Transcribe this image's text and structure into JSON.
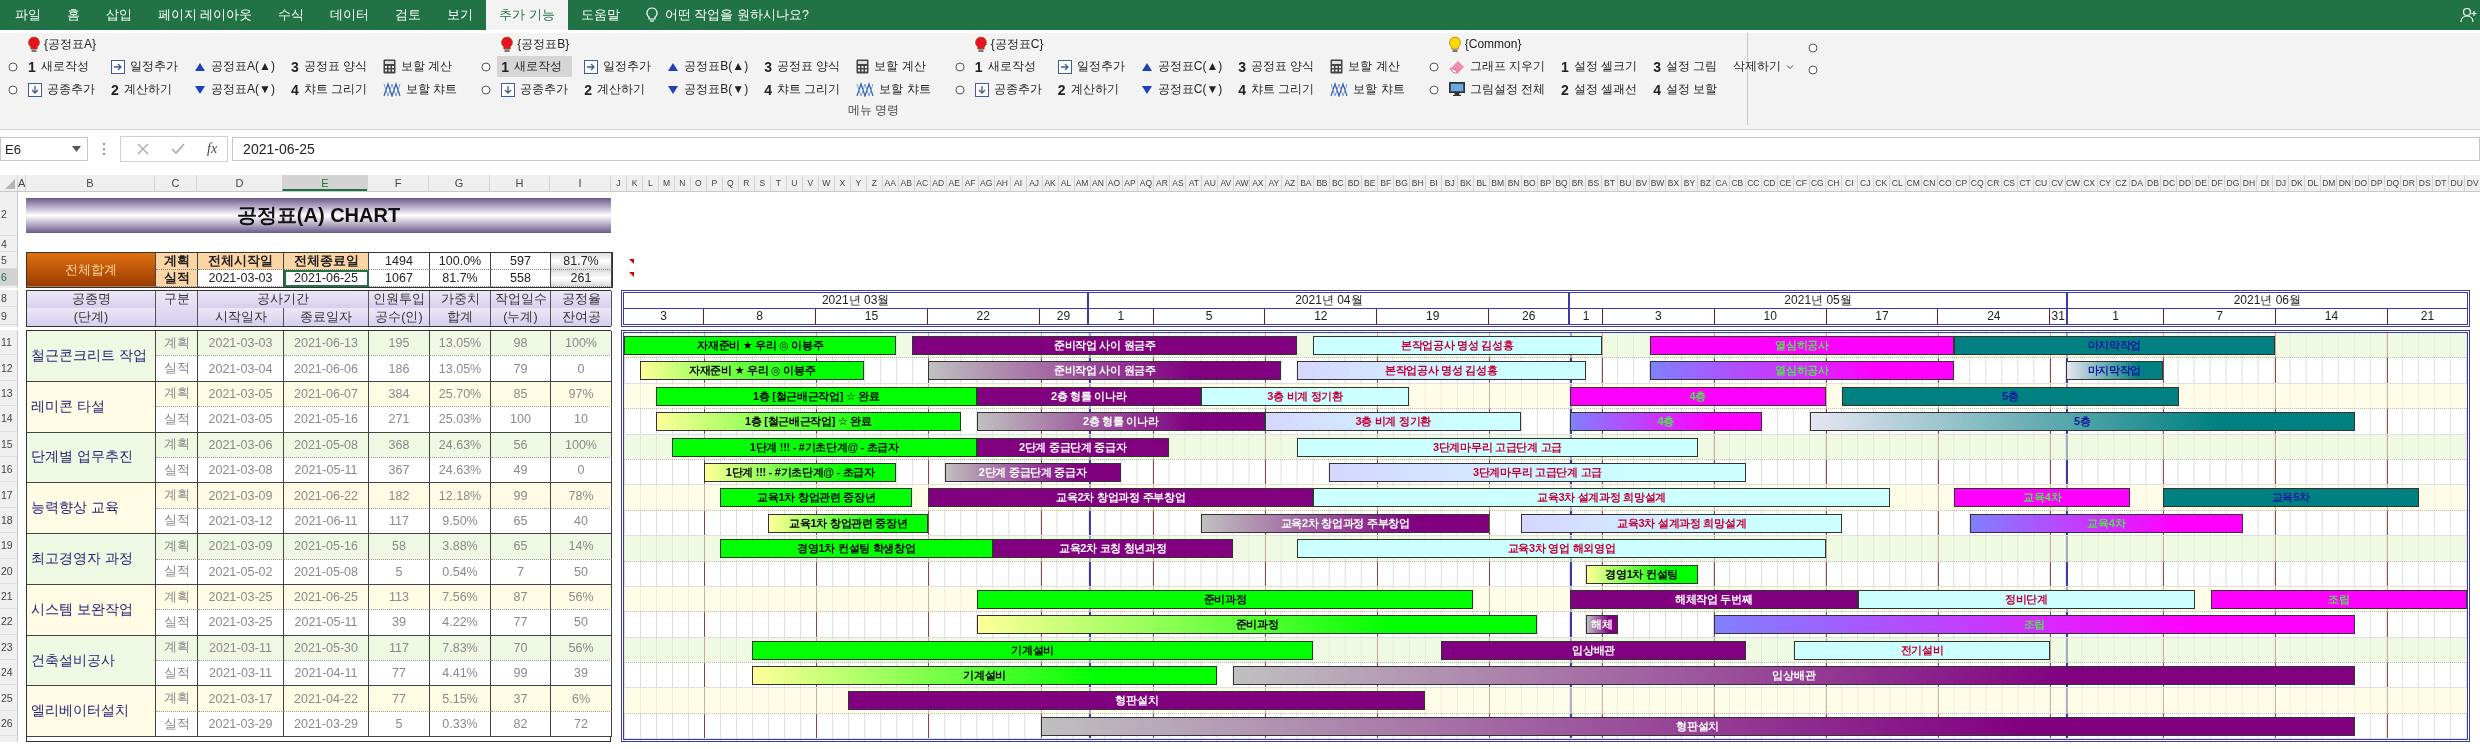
{
  "tabs": [
    {
      "label": "파일",
      "selected": false
    },
    {
      "label": "홈",
      "selected": false
    },
    {
      "label": "삽입",
      "selected": false
    },
    {
      "label": "페이지 레이아웃",
      "selected": false
    },
    {
      "label": "수식",
      "selected": false
    },
    {
      "label": "데이터",
      "selected": false
    },
    {
      "label": "검토",
      "selected": false
    },
    {
      "label": "보기",
      "selected": false
    },
    {
      "label": "추가 기능",
      "selected": true
    },
    {
      "label": "도움말",
      "selected": false
    }
  ],
  "tell_me": "어떤 작업을 원하시나요?",
  "ribbon": {
    "label": "메뉴 명령",
    "groups": [
      {
        "title": "{공정표A}",
        "color": "#e81123",
        "items": [
          {
            "kind": "numbered",
            "number": "1",
            "label": "새로작성",
            "highlighted": false
          },
          {
            "kind": "schedule-add",
            "label": "일정추가",
            "highlighted": false
          },
          {
            "kind": "move-up",
            "label": "공정표A(▲)",
            "highlighted": false
          },
          {
            "kind": "numbered",
            "number": "3",
            "label": "공정표 양식",
            "highlighted": false
          },
          {
            "kind": "calculator",
            "label": "보할 계산",
            "highlighted": false
          },
          {
            "kind": "item-add",
            "label": "공종추가",
            "highlighted": false
          },
          {
            "kind": "numbered",
            "number": "2",
            "label": "계산하기",
            "highlighted": false
          },
          {
            "kind": "move-down",
            "label": "공정표A(▼)",
            "highlighted": false
          },
          {
            "kind": "numbered",
            "number": "4",
            "label": "챠트 그리기",
            "highlighted": false
          },
          {
            "kind": "chart",
            "label": "보할 챠트",
            "highlighted": false
          }
        ]
      },
      {
        "title": "{공정표B}",
        "color": "#e81123",
        "items": [
          {
            "kind": "numbered",
            "number": "1",
            "label": "새로작성",
            "highlighted": true
          },
          {
            "kind": "schedule-add",
            "label": "일정추가",
            "highlighted": false
          },
          {
            "kind": "move-up",
            "label": "공정표B(▲)",
            "highlighted": false
          },
          {
            "kind": "numbered",
            "number": "3",
            "label": "공정표 양식",
            "highlighted": false
          },
          {
            "kind": "calculator",
            "label": "보할 계산",
            "highlighted": false
          },
          {
            "kind": "item-add",
            "label": "공종추가",
            "highlighted": false
          },
          {
            "kind": "numbered",
            "number": "2",
            "label": "계산하기",
            "highlighted": false
          },
          {
            "kind": "move-down",
            "label": "공정표B(▼)",
            "highlighted": false
          },
          {
            "kind": "numbered",
            "number": "4",
            "label": "챠트 그리기",
            "highlighted": false
          },
          {
            "kind": "chart",
            "label": "보할 챠트",
            "highlighted": false
          }
        ]
      },
      {
        "title": "{공정표C}",
        "color": "#e81123",
        "items": [
          {
            "kind": "numbered",
            "number": "1",
            "label": "새로작성",
            "highlighted": false
          },
          {
            "kind": "schedule-add",
            "label": "일정추가",
            "highlighted": false
          },
          {
            "kind": "move-up",
            "label": "공정표C(▲)",
            "highlighted": false
          },
          {
            "kind": "numbered",
            "number": "3",
            "label": "공정표 양식",
            "highlighted": false
          },
          {
            "kind": "calculator",
            "label": "보할 계산",
            "highlighted": false
          },
          {
            "kind": "item-add",
            "label": "공종추가",
            "highlighted": false
          },
          {
            "kind": "numbered",
            "number": "2",
            "label": "계산하기",
            "highlighted": false
          },
          {
            "kind": "move-down",
            "label": "공정표C(▼)",
            "highlighted": false
          },
          {
            "kind": "numbered",
            "number": "4",
            "label": "챠트 그리기",
            "highlighted": false
          },
          {
            "kind": "chart",
            "label": "보할 챠트",
            "highlighted": false
          }
        ]
      },
      {
        "title": "{Common}",
        "color": "#ffd800",
        "items": [
          {
            "kind": "eraser",
            "label": "그래프 지우기",
            "highlighted": false
          },
          {
            "kind": "numbered",
            "number": "1",
            "label": "설정 셀크기",
            "highlighted": false
          },
          {
            "kind": "numbered",
            "number": "3",
            "label": "설정 그림",
            "highlighted": false
          },
          {
            "kind": "dropdown",
            "label": "삭제하기",
            "highlighted": false
          },
          {
            "kind": "monitor",
            "label": "그림설정 전체",
            "highlighted": false
          },
          {
            "kind": "numbered",
            "number": "2",
            "label": "설정 셀괘선",
            "highlighted": false
          },
          {
            "kind": "numbered",
            "number": "4",
            "label": "설정 보할",
            "highlighted": false
          }
        ]
      }
    ]
  },
  "formula_bar": {
    "name_box": "E6",
    "fx": "fx",
    "value": "2021-06-25"
  },
  "column_headers": [
    {
      "label": "A",
      "selected": false
    },
    {
      "label": "B",
      "selected": false
    },
    {
      "label": "C",
      "selected": false
    },
    {
      "label": "D",
      "selected": false
    },
    {
      "label": "E",
      "selected": true
    },
    {
      "label": "F",
      "selected": false
    },
    {
      "label": "G",
      "selected": false
    },
    {
      "label": "H",
      "selected": false
    },
    {
      "label": "I",
      "selected": false
    }
  ],
  "gantt_column_headers": [
    "J",
    "K",
    "L",
    "M",
    "N",
    "O",
    "P",
    "Q",
    "R",
    "S",
    "T",
    "U",
    "V",
    "W",
    "X",
    "Y",
    "Z",
    "AA",
    "AB",
    "AC",
    "AD",
    "AE",
    "AF",
    "AG",
    "AH",
    "AI",
    "AJ",
    "AK",
    "AL",
    "AM",
    "AN",
    "AO",
    "AP",
    "AQ",
    "AR",
    "AS",
    "AT",
    "AU",
    "AV",
    "AW",
    "AX",
    "AY",
    "AZ",
    "BA",
    "BB",
    "BC",
    "BD",
    "BE",
    "BF",
    "BG",
    "BH",
    "BI",
    "BJ",
    "BK",
    "BL",
    "BM",
    "BN",
    "BO",
    "BP",
    "BQ",
    "BR",
    "BS",
    "BT",
    "BU",
    "BV",
    "BW",
    "BX",
    "BY",
    "BZ",
    "CA",
    "CB",
    "CC",
    "CD",
    "CE",
    "CF",
    "CG",
    "CH",
    "CI",
    "CJ",
    "CK",
    "CL",
    "CM",
    "CN",
    "CO",
    "CP",
    "CQ",
    "CR",
    "CS",
    "CT",
    "CU",
    "CV",
    "CW",
    "CX",
    "CY",
    "CZ",
    "DA",
    "DB",
    "DC",
    "DD",
    "DE",
    "DF",
    "DG",
    "DH",
    "DI",
    "DJ",
    "DK",
    "DL",
    "DM",
    "DN",
    "DO",
    "DP",
    "DQ",
    "DR",
    "DS",
    "DT",
    "DU",
    "DV"
  ],
  "row_numbers": [
    {
      "label": "2",
      "selected": false
    },
    {
      "label": "4",
      "selected": false
    },
    {
      "label": "5",
      "selected": false
    },
    {
      "label": "6",
      "selected": true
    },
    {
      "label": "8",
      "selected": false
    },
    {
      "label": "9",
      "selected": false
    },
    {
      "label": "11",
      "selected": false
    },
    {
      "label": "12",
      "selected": false
    },
    {
      "label": "13",
      "selected": false
    },
    {
      "label": "14",
      "selected": false
    },
    {
      "label": "15",
      "selected": false
    },
    {
      "label": "16",
      "selected": false
    },
    {
      "label": "17",
      "selected": false
    },
    {
      "label": "18",
      "selected": false
    },
    {
      "label": "19",
      "selected": false
    },
    {
      "label": "20",
      "selected": false
    },
    {
      "label": "21",
      "selected": false
    },
    {
      "label": "22",
      "selected": false
    },
    {
      "label": "23",
      "selected": false
    },
    {
      "label": "24",
      "selected": false
    },
    {
      "label": "25",
      "selected": false
    },
    {
      "label": "26",
      "selected": false
    }
  ],
  "title": "공정표(A) CHART",
  "summary": {
    "title": "전체합계",
    "plan_label": "계획",
    "actual_label": "실적",
    "start_header": "전체시작일",
    "end_header": "전체종료일",
    "start": "2021-03-03",
    "end": "2021-06-25",
    "plan_values": [
      "1494",
      "100.0%",
      "597",
      "81.7%"
    ],
    "actual_values": [
      "1067",
      "81.7%",
      "558",
      "261"
    ]
  },
  "table_header": {
    "name": [
      "공종명",
      "(단계)"
    ],
    "type": "구분",
    "period": "공사기간",
    "period_columns": [
      "시작일자",
      "종료일자"
    ],
    "metrics": [
      [
        "인원투입",
        "공수(인)"
      ],
      [
        "가중치",
        "합계"
      ],
      [
        "작업일수",
        "(누계)"
      ],
      [
        "공정율",
        "잔여공"
      ]
    ]
  },
  "timeline": {
    "months": [
      {
        "label": "2021년 03월",
        "weeks": [
          "3",
          "8",
          "15",
          "22",
          "29"
        ]
      },
      {
        "label": "2021년 04월",
        "weeks": [
          "1",
          "5",
          "12",
          "19",
          "26"
        ]
      },
      {
        "label": "2021년 05월",
        "weeks": [
          "1",
          "3",
          "10",
          "17",
          "24",
          "31"
        ]
      },
      {
        "label": "2021년 06월",
        "weeks": [
          "1",
          "7",
          "14",
          "21"
        ]
      }
    ]
  },
  "tasks": [
    {
      "name": "철근콘크리트 작업",
      "rows": [
        {
          "kind": "plan",
          "label": "계획",
          "start": "2021-03-03",
          "end": "2021-06-13",
          "manpower": "195",
          "weight": "13.05%",
          "days": "98",
          "rate": "100%",
          "bars": [
            {
              "label": "자재준비 ★ 우리 ◎ 이봉주",
              "color": "#00ff00"
            },
            {
              "label": "준비작업 사이 원금주",
              "color": "#800080"
            },
            {
              "label": "본작업공사 명성 김성홍",
              "color": "#ccffff"
            },
            {
              "label": "열심히공사",
              "color": "#ff00ff"
            },
            {
              "label": "마지막작업",
              "color": "#008080"
            }
          ]
        },
        {
          "kind": "actual",
          "label": "실적",
          "start": "2021-03-04",
          "end": "2021-06-06",
          "manpower": "186",
          "weight": "13.05%",
          "days": "79",
          "rate": "0",
          "bars": [
            {
              "label": "자재준비 ★ 우리 ◎ 이봉주",
              "color": "#00ff00"
            },
            {
              "label": "준비작업 사이 원금주",
              "color": "#800080"
            },
            {
              "label": "본작업공사 명성 김성홍",
              "color": "#ccffff"
            },
            {
              "label": "열심히공사",
              "color": "#ff00ff"
            },
            {
              "label": "마지막작업",
              "color": "#008080"
            }
          ]
        }
      ]
    },
    {
      "name": "레미콘 타설",
      "rows": [
        {
          "kind": "plan",
          "label": "계획",
          "start": "2021-03-05",
          "end": "2021-06-07",
          "manpower": "384",
          "weight": "25.70%",
          "days": "85",
          "rate": "97%",
          "bars": [
            {
              "label": "1층 [철근배근작업] ☆ 완료",
              "color": "#00ff00"
            },
            {
              "label": "2층 형틀 이나라",
              "color": "#800080"
            },
            {
              "label": "3층 비계 정기환",
              "color": "#ccffff"
            },
            {
              "label": "4층",
              "color": "#ff00ff"
            },
            {
              "label": "5층",
              "color": "#008080"
            }
          ]
        },
        {
          "kind": "actual",
          "label": "실적",
          "start": "2021-03-05",
          "end": "2021-05-16",
          "manpower": "271",
          "weight": "25.03%",
          "days": "100",
          "rate": "10",
          "bars": [
            {
              "label": "1층 [철근배근작업] ☆ 완료",
              "color": "#00ff00"
            },
            {
              "label": "2층 형틀 이나라",
              "color": "#800080"
            },
            {
              "label": "3층 비계 정기환",
              "color": "#ccffff"
            },
            {
              "label": "4층",
              "color": "#ff00ff"
            },
            {
              "label": "5층",
              "color": "#008080"
            }
          ]
        }
      ]
    },
    {
      "name": "단계별 업무추진",
      "rows": [
        {
          "kind": "plan",
          "label": "계획",
          "start": "2021-03-06",
          "end": "2021-05-08",
          "manpower": "368",
          "weight": "24.63%",
          "days": "56",
          "rate": "100%",
          "bars": [
            {
              "label": "1단계 !!! - #기초단계@ - 초급자",
              "color": "#00ff00"
            },
            {
              "label": "2단계 중급단계 중급자",
              "color": "#800080"
            },
            {
              "label": "3단계마무리 고급단계 고급",
              "color": "#ccffff"
            }
          ]
        },
        {
          "kind": "actual",
          "label": "실적",
          "start": "2021-03-08",
          "end": "2021-05-11",
          "manpower": "367",
          "weight": "24.63%",
          "days": "49",
          "rate": "0",
          "bars": [
            {
              "label": "1단계 !!! - #기초단계@ - 초급자",
              "color": "#00ff00"
            },
            {
              "label": "2단계 중급단계 중급자",
              "color": "#800080"
            },
            {
              "label": "3단계마무리 고급단계 고급",
              "color": "#ccffff"
            }
          ]
        }
      ]
    },
    {
      "name": "능력향상 교육",
      "rows": [
        {
          "kind": "plan",
          "label": "계획",
          "start": "2021-03-09",
          "end": "2021-06-22",
          "manpower": "182",
          "weight": "12.18%",
          "days": "99",
          "rate": "78%",
          "bars": [
            {
              "label": "교육1차 창업관련 중장년",
              "color": "#00ff00"
            },
            {
              "label": "교육2차 창업과정 주부창업",
              "color": "#800080"
            },
            {
              "label": "교육3차 설계과정 희망설계",
              "color": "#ccffff"
            },
            {
              "label": "교육4차",
              "color": "#ff00ff"
            },
            {
              "label": "교육5차",
              "color": "#008080"
            }
          ]
        },
        {
          "kind": "actual",
          "label": "실적",
          "start": "2021-03-12",
          "end": "2021-06-11",
          "manpower": "117",
          "weight": "9.50%",
          "days": "65",
          "rate": "40",
          "bars": [
            {
              "label": "교육1차 창업관련 중장년",
              "color": "#00ff00"
            },
            {
              "label": "교육2차 창업과정 주부창업",
              "color": "#800080"
            },
            {
              "label": "교육3차 설계과정 희망설계",
              "color": "#ccffff"
            },
            {
              "label": "교육4차",
              "color": "#ff00ff"
            }
          ]
        }
      ]
    },
    {
      "name": "최고경영자 과정",
      "rows": [
        {
          "kind": "plan",
          "label": "계획",
          "start": "2021-03-09",
          "end": "2021-05-16",
          "manpower": "58",
          "weight": "3.88%",
          "days": "65",
          "rate": "14%",
          "bars": [
            {
              "label": "경영1차 컨설팅 학생창업",
              "color": "#00ff00"
            },
            {
              "label": "교육2차 코칭 청년과정",
              "color": "#800080"
            },
            {
              "label": "교육3차 영업 해외영업",
              "color": "#ccffff"
            }
          ]
        },
        {
          "kind": "actual",
          "label": "실적",
          "start": "2021-05-02",
          "end": "2021-05-08",
          "manpower": "5",
          "weight": "0.54%",
          "days": "7",
          "rate": "50",
          "bars": [
            {
              "label": "경영1차 컨설팅",
              "color": "#00ff00"
            }
          ]
        }
      ]
    },
    {
      "name": "시스템 보완작업",
      "rows": [
        {
          "kind": "plan",
          "label": "계획",
          "start": "2021-03-25",
          "end": "2021-06-25",
          "manpower": "113",
          "weight": "7.56%",
          "days": "87",
          "rate": "56%",
          "bars": [
            {
              "label": "준비과정",
              "color": "#00ff00"
            },
            {
              "label": "해체작업 두번째",
              "color": "#800080"
            },
            {
              "label": "정비단계",
              "color": "#ccffff"
            },
            {
              "label": "조립",
              "color": "#ff00ff"
            }
          ]
        },
        {
          "kind": "actual",
          "label": "실적",
          "start": "2021-03-25",
          "end": "2021-05-11",
          "manpower": "39",
          "weight": "4.22%",
          "days": "77",
          "rate": "50",
          "bars": [
            {
              "label": "준비과정",
              "color": "#00ff00"
            },
            {
              "label": "해체",
              "color": "#800080"
            },
            {
              "label": "조립",
              "color": "#ff00ff"
            }
          ]
        }
      ]
    },
    {
      "name": "건축설비공사",
      "rows": [
        {
          "kind": "plan",
          "label": "계획",
          "start": "2021-03-11",
          "end": "2021-05-30",
          "manpower": "117",
          "weight": "7.83%",
          "days": "70",
          "rate": "56%",
          "bars": [
            {
              "label": "기계설비",
              "color": "#00ff00"
            },
            {
              "label": "입상배관",
              "color": "#800080"
            },
            {
              "label": "전기설비",
              "color": "#ccffff"
            }
          ]
        },
        {
          "kind": "actual",
          "label": "실적",
          "start": "2021-03-11",
          "end": "2021-04-11",
          "manpower": "77",
          "weight": "4.41%",
          "days": "99",
          "rate": "39",
          "bars": [
            {
              "label": "기계설비",
              "color": "#00ff00"
            },
            {
              "label": "입상배관",
              "color": "#800080"
            }
          ]
        }
      ]
    },
    {
      "name": "엘리베이터설치",
      "rows": [
        {
          "kind": "plan",
          "label": "계획",
          "start": "2021-03-17",
          "end": "2021-04-22",
          "manpower": "77",
          "weight": "5.15%",
          "days": "37",
          "rate": "6%",
          "bars": [
            {
              "label": "형판설치",
              "color": "#800080"
            }
          ]
        },
        {
          "kind": "actual",
          "label": "실적",
          "start": "2021-03-29",
          "end": "2021-03-29",
          "manpower": "5",
          "weight": "0.33%",
          "days": "82",
          "rate": "72",
          "bars": [
            {
              "label": "형판설치",
              "color": "#800080"
            }
          ]
        }
      ]
    }
  ]
}
